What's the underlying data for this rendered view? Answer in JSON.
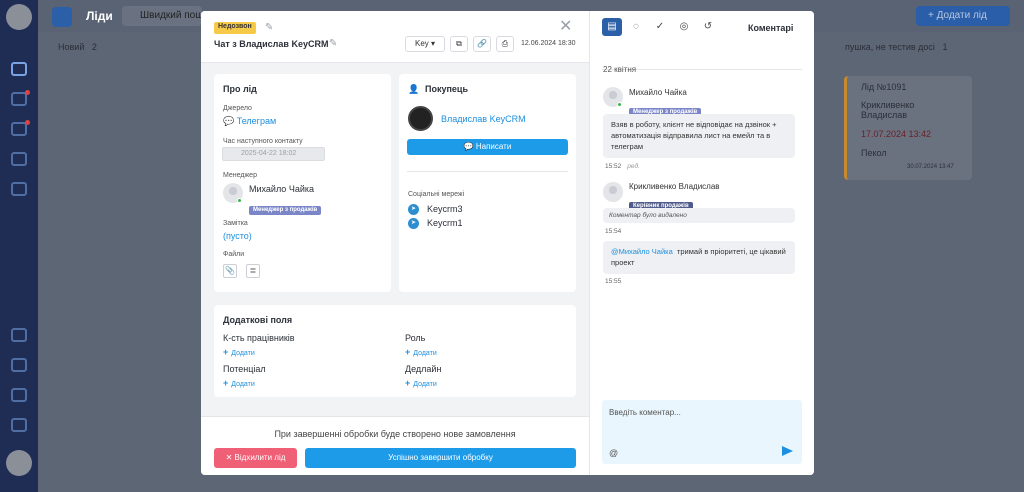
{
  "topbar": {
    "title": "Ліди",
    "search_placeholder": "Швидкий пош",
    "add_label": "+ Додати лід"
  },
  "background": {
    "col1": "Новий",
    "col1_count": "2",
    "col2": "пушка, не тестив досі",
    "col2_count": "1",
    "card": {
      "id": "Лід №1091",
      "name": "Крикливенко Владислав",
      "date": "17.07.2024 13:42",
      "status": "Пекол",
      "time": "30.07.2024 13:47"
    }
  },
  "modal": {
    "status": "Недозвон",
    "chat_title": "Чат з Владислав KeyCRM",
    "key_btn": "Key ▾",
    "date": "12.06.2024 18:30",
    "lead": {
      "title": "Про лід",
      "source_label": "Джерело",
      "source_value": "Телеграм",
      "next_contact_label": "Час наступного контакту",
      "next_contact_value": "2025-04-22 18:02",
      "manager_label": "Менеджер",
      "manager_name": "Михайло Чайка",
      "manager_role": "Менеджер з продажів",
      "note_label": "Замітка",
      "note_value": "(пусто)",
      "files_label": "Файли"
    },
    "buyer": {
      "title": "Покупець",
      "name": "Владислав KeyCRM",
      "write_btn": "Написати",
      "social_label": "Соціальні мережі",
      "socials": [
        "Keycrm3",
        "Keycrm1"
      ]
    },
    "extra": {
      "title": "Додаткові поля",
      "fields": [
        "К-сть працівників",
        "Роль",
        "Потенціал",
        "Дедлайн"
      ],
      "add_label": "Додати"
    },
    "footer": {
      "text": "При завершенні обробки буде створено нове замовлення",
      "reject_btn": "Відхилити лід",
      "complete_btn": "Успішно завершити обробку"
    }
  },
  "comments": {
    "title": "Коментарі",
    "date_sep": "22 квітня",
    "messages": [
      {
        "name": "Михайло Чайка",
        "role": "Менеджер з продажів",
        "text": "Взяв в роботу, клієнт не відповідає на дзвінок + автоматизація відправила лист на емейл та в телеграм",
        "time": "15:52",
        "edited": "ред."
      },
      {
        "name": "Крикливенко Владислав",
        "role": "Керівник продажів",
        "text": "Коментар було видалено",
        "time": "15:54"
      },
      {
        "mention": "@Михайло Чайка",
        "text": "тримай в пріоритеті, це цікавий проект",
        "time": "15:55"
      }
    ],
    "input_placeholder": "Введіть коментар..."
  },
  "colors": {
    "primary": "#1d9be9",
    "reject": "#ef5f75",
    "status": "#f7c948",
    "active_tab": "#2b5fa8"
  }
}
